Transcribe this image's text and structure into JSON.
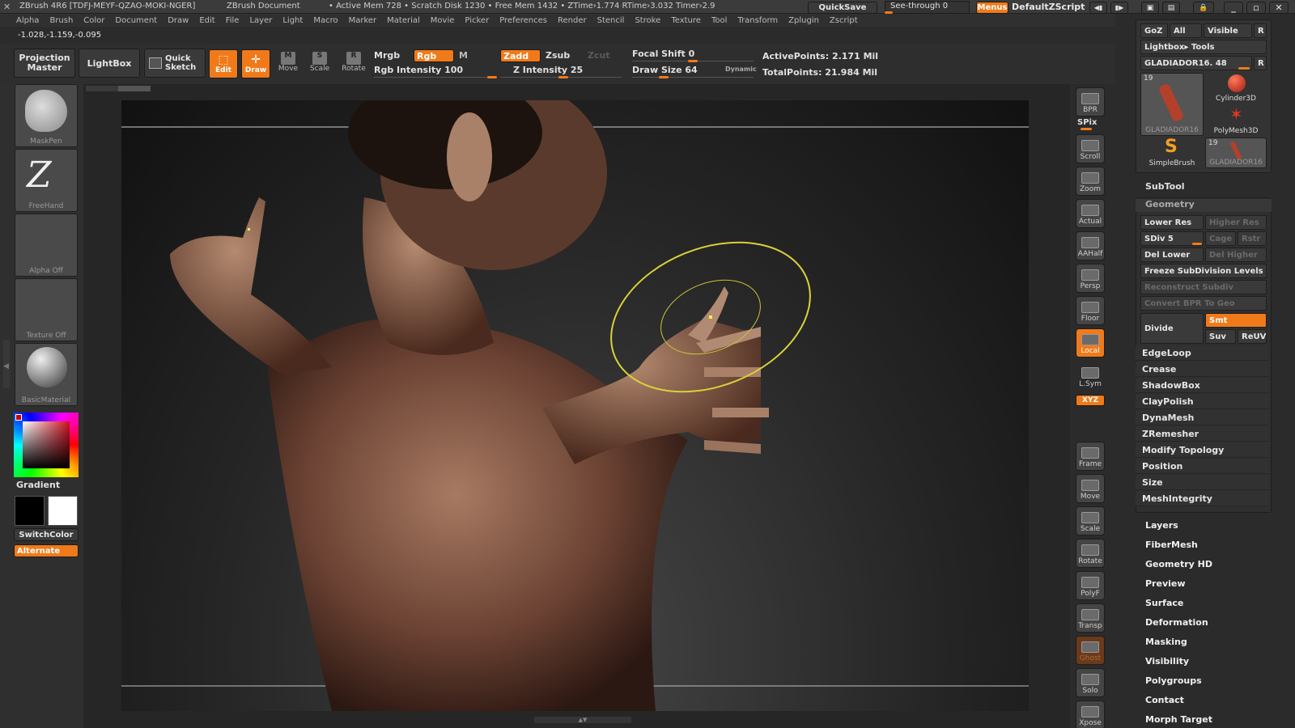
{
  "titlebar": {
    "app": "ZBrush 4R6 [TDFJ-MEYF-QZAO-MOKI-NGER]",
    "doc": "ZBrush Document",
    "stats": "• Active Mem 728 • Scratch Disk 1230 • Free Mem 1432 • ZTime›1.774 RTime›3.032 Timer›2.9",
    "quicksave": "QuickSave",
    "seethrough": "See-through  0",
    "menus": "Menus",
    "script": "DefaultZScript"
  },
  "menubar": [
    "Alpha",
    "Brush",
    "Color",
    "Document",
    "Draw",
    "Edit",
    "File",
    "Layer",
    "Light",
    "Macro",
    "Marker",
    "Material",
    "Movie",
    "Picker",
    "Preferences",
    "Render",
    "Stencil",
    "Stroke",
    "Texture",
    "Tool",
    "Transform",
    "Zplugin",
    "Zscript"
  ],
  "coords": "-1.028,-1.159,-0.095",
  "toolbar": {
    "projection_master": "Projection Master",
    "lightbox": "LightBox",
    "quick_sketch": "Quick Sketch",
    "edit": "Edit",
    "draw": "Draw",
    "move": "Move",
    "scale": "Scale",
    "rotate": "Rotate",
    "mrgb": "Mrgb",
    "rgb": "Rgb",
    "m": "M",
    "zadd": "Zadd",
    "zsub": "Zsub",
    "zcut": "Zcut",
    "rgb_intensity": "Rgb Intensity 100",
    "z_intensity": "Z Intensity 25",
    "focal_shift": "Focal Shift 0",
    "draw_size": "Draw Size 64",
    "dynamic": "Dynamic",
    "active_points": "ActivePoints: 2.171  Mil",
    "total_points": "TotalPoints: 21.984  Mil"
  },
  "left_shelf": {
    "maskpen": "MaskPen",
    "freehand": "FreeHand",
    "alpha": "Alpha  Off",
    "texture": "Texture  Off",
    "material": "BasicMaterial",
    "gradient": "Gradient",
    "switchcolor": "SwitchColor",
    "alternate": "Alternate"
  },
  "right_shelf": [
    "BPR",
    "SPix",
    "Scroll",
    "Zoom",
    "Actual",
    "AAHalf",
    "Persp",
    "Floor",
    "Local",
    "L.Sym",
    "Frame",
    "Move",
    "Scale",
    "Rotate",
    "PolyF",
    "Transp",
    "Ghost",
    "Solo",
    "Xpose"
  ],
  "right_shelf_xyz": "XYZ",
  "tool_panel": {
    "goz": "GoZ",
    "all": "All",
    "visible": "Visible",
    "r": "R",
    "lightbox_tools": "Lightbox▸ Tools",
    "current_tool": "GLADIADOR16. 48",
    "thumbs": [
      {
        "name": "GLADIADOR16",
        "count": "19"
      },
      {
        "name": "Cylinder3D"
      },
      {
        "name": "PolyMesh3D"
      },
      {
        "name": "SimpleBrush"
      },
      {
        "name": "GLADIADOR16",
        "count": "19"
      }
    ],
    "subtool": "SubTool",
    "geometry": "Geometry",
    "lower_res": "Lower Res",
    "higher_res": "Higher Res",
    "sdiv": "SDiv 5",
    "cage": "Cage",
    "rstr": "Rstr",
    "del_lower": "Del Lower",
    "del_higher": "Del Higher",
    "freeze": "Freeze SubDivision Levels",
    "reconstruct": "Reconstruct Subdiv",
    "convert_bpr": "Convert BPR To Geo",
    "divide": "Divide",
    "smt": "Smt",
    "suv": "Suv",
    "reuv": "ReUV",
    "geo_items": [
      "EdgeLoop",
      "Crease",
      "ShadowBox",
      "ClayPolish",
      "DynaMesh",
      "ZRemesher",
      "Modify Topology",
      "Position",
      "Size",
      "MeshIntegrity"
    ],
    "sections": [
      "Layers",
      "FiberMesh",
      "Geometry HD",
      "Preview",
      "Surface",
      "Deformation",
      "Masking",
      "Visibility",
      "Polygroups",
      "Contact",
      "Morph Target"
    ]
  },
  "colors": {
    "accent": "#f07a1a",
    "panel": "#2f2f2f",
    "brush_ring": "#d8d23a"
  }
}
